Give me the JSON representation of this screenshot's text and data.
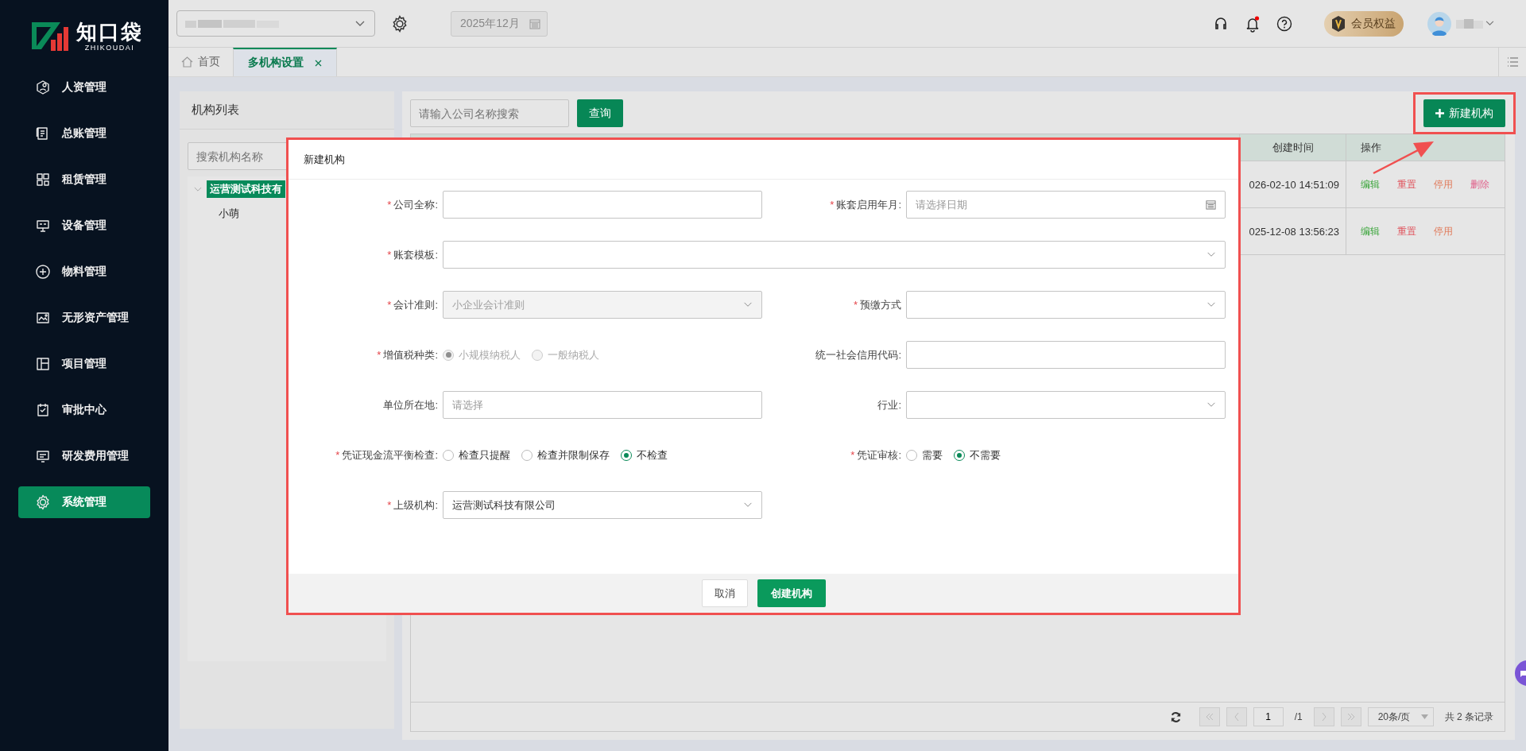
{
  "sidebar": {
    "logo": {
      "name": "知口袋",
      "subtitle": "ZHIKOUDAI"
    },
    "items": [
      {
        "label": "人资管理",
        "selected": false
      },
      {
        "label": "总账管理",
        "selected": false
      },
      {
        "label": "租赁管理",
        "selected": false
      },
      {
        "label": "设备管理",
        "selected": false
      },
      {
        "label": "物料管理",
        "selected": false
      },
      {
        "label": "无形资产管理",
        "selected": false
      },
      {
        "label": "项目管理",
        "selected": false
      },
      {
        "label": "审批中心",
        "selected": false
      },
      {
        "label": "研发费用管理",
        "selected": false
      },
      {
        "label": "系统管理",
        "selected": true
      }
    ]
  },
  "topbar": {
    "period": "2025年12月",
    "has_unread": true,
    "vip_badge": "会员权益"
  },
  "tabs": [
    {
      "label": "首页",
      "selected": false,
      "closable": false
    },
    {
      "label": "多机构设置",
      "selected": true,
      "closable": true
    }
  ],
  "org_panel": {
    "title": "机构列表",
    "search": {
      "placeholder": "搜索机构名称"
    },
    "tree": [
      {
        "label": "运营测试科技有",
        "selected": true,
        "expanded": true,
        "children": [
          {
            "label": "小萌",
            "selected": false
          }
        ]
      }
    ]
  },
  "org_list": {
    "search": {
      "placeholder": "请输入公司名称搜索"
    },
    "query_button": "查询",
    "new_button": "新建机构",
    "table": {
      "columns": [
        "创建时间",
        "操作"
      ],
      "rows": [
        {
          "created": "026-02-10 14:51:09",
          "actions": [
            {
              "label": "编辑",
              "kind": "edit"
            },
            {
              "label": "重置",
              "kind": "reset"
            },
            {
              "label": "停用",
              "kind": "disable"
            },
            {
              "label": "删除",
              "kind": "delete"
            }
          ]
        },
        {
          "created": "025-12-08 13:56:23",
          "actions": [
            {
              "label": "编辑",
              "kind": "edit"
            },
            {
              "label": "重置",
              "kind": "reset"
            },
            {
              "label": "停用",
              "kind": "disable"
            }
          ]
        }
      ]
    },
    "pagination": {
      "page": "1",
      "total_pages": "/1",
      "page_size": "20条/页",
      "total": "共 2 条记录"
    }
  },
  "dialog": {
    "title": "新建机构",
    "required_mark": "*",
    "fields": [
      {
        "label": "公司全称:",
        "required": true,
        "kind": "text"
      },
      {
        "label": "账套启用年月:",
        "required": true,
        "kind": "date",
        "placeholder": "请选择日期"
      },
      {
        "label": "账套模板:",
        "required": true,
        "kind": "select",
        "wide": true
      },
      {
        "label": "会计准则:",
        "required": true,
        "kind": "select",
        "disabled": true,
        "value": "小企业会计准则"
      },
      {
        "label": "预缴方式",
        "required": true,
        "kind": "select"
      },
      {
        "label": "增值税种类:",
        "required": true,
        "kind": "radio",
        "disabled": true,
        "options": [
          {
            "label": "小规模纳税人",
            "selected": true
          },
          {
            "label": "一般纳税人",
            "selected": false
          }
        ]
      },
      {
        "label": "统一社会信用代码:",
        "required": false,
        "kind": "text"
      },
      {
        "label": "单位所在地:",
        "required": false,
        "kind": "text",
        "placeholder": "请选择"
      },
      {
        "label": "行业:",
        "required": false,
        "kind": "select"
      },
      {
        "label": "凭证现金流平衡检查:",
        "required": true,
        "kind": "radio",
        "options": [
          {
            "label": "检查只提醒",
            "selected": false
          },
          {
            "label": "检查并限制保存",
            "selected": false
          },
          {
            "label": "不检查",
            "selected": true
          }
        ]
      },
      {
        "label": "凭证审核:",
        "required": true,
        "kind": "radio",
        "options": [
          {
            "label": "需要",
            "selected": false
          },
          {
            "label": "不需要",
            "selected": true
          }
        ]
      },
      {
        "label": "上级机构:",
        "required": true,
        "kind": "select",
        "value": "运营测试科技有限公司"
      }
    ],
    "buttons": [
      {
        "label": "取消",
        "kind": "secondary"
      },
      {
        "label": "创建机构",
        "kind": "primary"
      }
    ]
  }
}
